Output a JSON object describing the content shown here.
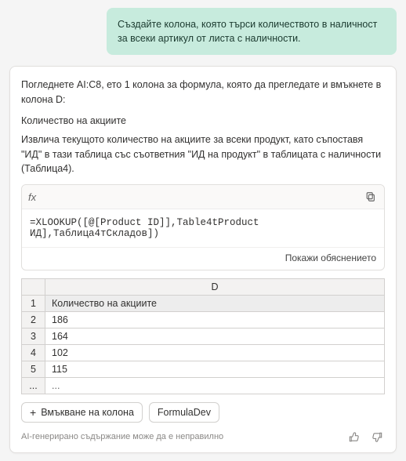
{
  "user_message": "Създайте колона, която търси количеството в наличност за всеки артикул от листа с наличности.",
  "response": {
    "intro": "Погледнете AI:C8, ето 1 колона за формула, която да прегледате и вмъкнете в колона D:",
    "column_title": "Количество на акциите",
    "description": "Извлича текущото количество на акциите за всеки продукт, като съпоставя \"ИД\" в тази таблица със съответния \"ИД на продукт\" в таблицата с наличности (Таблица4).",
    "formula_label": "fx",
    "formula_text": "=XLOOKUP([@[Product ID]],Table4tProduct     ИД],Таблица4тСкладов])",
    "show_explanation": "Покажи обяснението",
    "preview": {
      "col_header_blank": "",
      "col_header_d": "D",
      "rows": [
        {
          "n": "1",
          "v": "Количество на акциите"
        },
        {
          "n": "2",
          "v": "186"
        },
        {
          "n": "3",
          "v": "164"
        },
        {
          "n": "4",
          "v": "102"
        },
        {
          "n": "5",
          "v": "115"
        },
        {
          "n": "...",
          "v": "..."
        }
      ]
    },
    "insert_button": "Вмъкване на колона",
    "formuladev_button": "FormulaDev",
    "disclaimer": "AI-генерирано съдържание може да е неправилно"
  }
}
